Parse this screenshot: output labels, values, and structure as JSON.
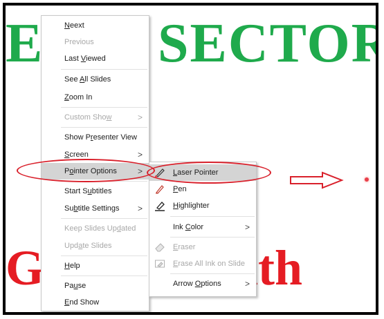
{
  "slide": {
    "title_top_left": "E",
    "title_top_right": "SECTOR",
    "title_bottom_left": "Ge",
    "title_bottom_right": "ith",
    "title_top_color": "#1faa4c",
    "title_bottom_color": "#e51c23",
    "laser_dot_color": "#e8404a"
  },
  "context_menu": {
    "items": [
      {
        "label": "Next",
        "enabled": true
      },
      {
        "label": "Previous",
        "enabled": false
      },
      {
        "label": "Last Viewed",
        "enabled": true
      },
      {
        "label": "See All Slides",
        "enabled": true
      },
      {
        "label": "Zoom In",
        "enabled": true
      },
      {
        "label": "Custom Show",
        "enabled": false,
        "submenu": true
      },
      {
        "label": "Show Presenter View",
        "enabled": true
      },
      {
        "label": "Screen",
        "enabled": true,
        "submenu": true
      },
      {
        "label": "Pointer Options",
        "enabled": true,
        "submenu": true,
        "highlighted": true
      },
      {
        "label": "Start Subtitles",
        "enabled": true
      },
      {
        "label": "Subtitle Settings",
        "enabled": true,
        "submenu": true
      },
      {
        "label": "Keep Slides Updated",
        "enabled": false
      },
      {
        "label": "Update Slides",
        "enabled": false
      },
      {
        "label": "Help",
        "enabled": true
      },
      {
        "label": "Pause",
        "enabled": true
      },
      {
        "label": "End Show",
        "enabled": true
      }
    ]
  },
  "pointer_submenu": {
    "items": [
      {
        "label": "Laser Pointer",
        "icon": "laser-pointer-icon",
        "enabled": true,
        "highlighted": true
      },
      {
        "label": "Pen",
        "icon": "pen-icon",
        "enabled": true
      },
      {
        "label": "Highlighter",
        "icon": "highlighter-icon",
        "enabled": true
      },
      {
        "label": "Ink Color",
        "enabled": true,
        "submenu": true
      },
      {
        "label": "Eraser",
        "icon": "eraser-icon",
        "enabled": false
      },
      {
        "label": "Erase All Ink on Slide",
        "icon": "erase-all-icon",
        "enabled": false
      },
      {
        "label": "Arrow Options",
        "enabled": true,
        "submenu": true
      }
    ]
  },
  "annotation": {
    "arrow": "right-arrow",
    "ellipse_color": "#d9202b"
  }
}
